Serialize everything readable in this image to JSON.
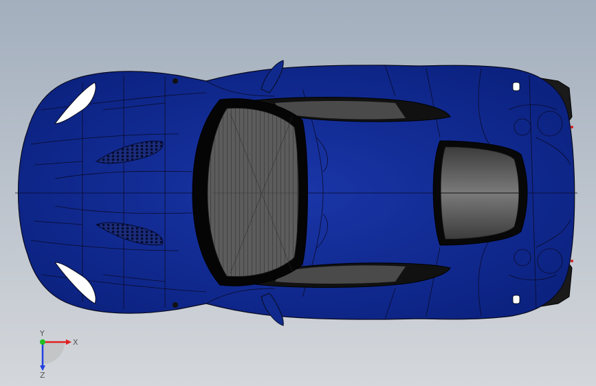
{
  "viewport": {
    "background_top": "#a3afbe",
    "background_bottom": "#d4d7db",
    "model_color": "#0f2a8c",
    "model_edge_color": "#0a0a1e",
    "glass_color": "#5a5a5a",
    "headlight_color": "#ffffff"
  },
  "triad": {
    "x_label": "X",
    "y_label": "Y",
    "z_label": "Z",
    "x_color": "#e02020",
    "y_color": "#20c020",
    "z_color": "#2040e0"
  }
}
